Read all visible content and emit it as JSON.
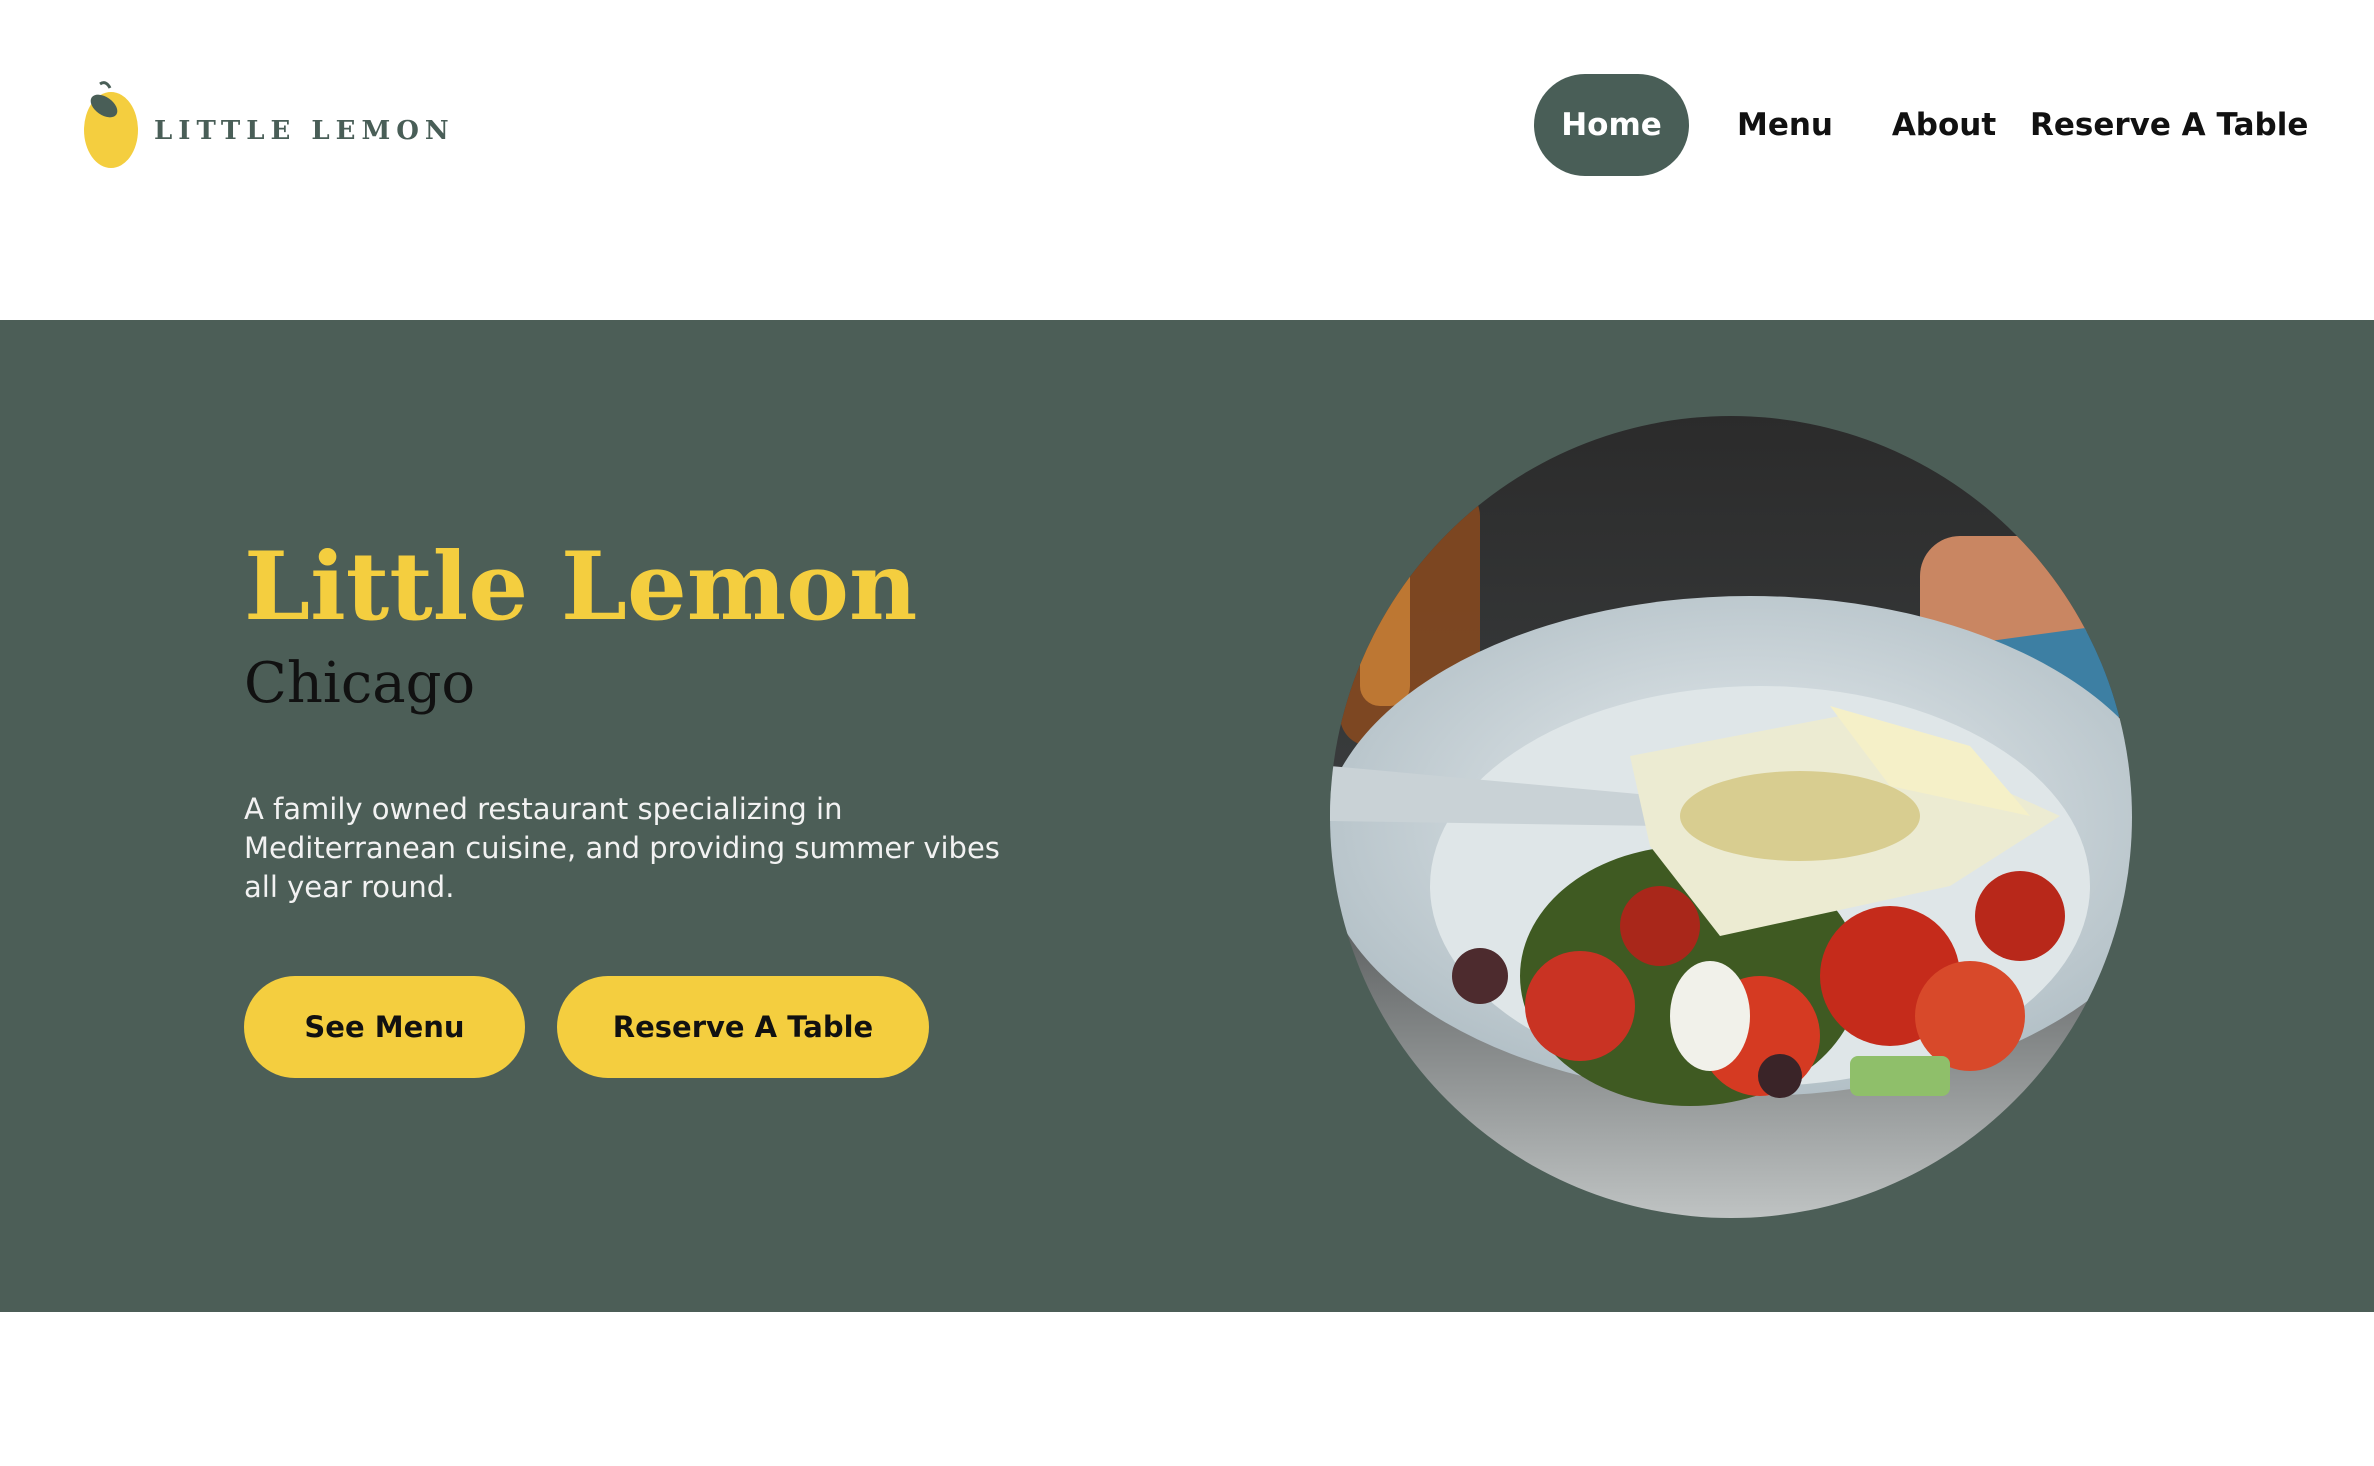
{
  "brand": {
    "name": "LITTLE LEMON",
    "colors": {
      "primary": "#495e57",
      "accent": "#f4ce3f",
      "hero_bg": "#4c5e57"
    },
    "logo_icon": "lemon-icon"
  },
  "nav": {
    "items": [
      {
        "label": "Home",
        "active": true
      },
      {
        "label": "Menu",
        "active": false
      },
      {
        "label": "About",
        "active": false
      },
      {
        "label": "Reserve A Table",
        "active": false
      }
    ]
  },
  "hero": {
    "title": "Little Lemon",
    "subtitle": "Chicago",
    "description": "A family owned restaurant specializing in Mediterranean cuisine, and providing summer vibes all year round.",
    "buttons": {
      "see_menu": "See Menu",
      "reserve": "Reserve A Table"
    },
    "image": "greek-salad-photo"
  }
}
